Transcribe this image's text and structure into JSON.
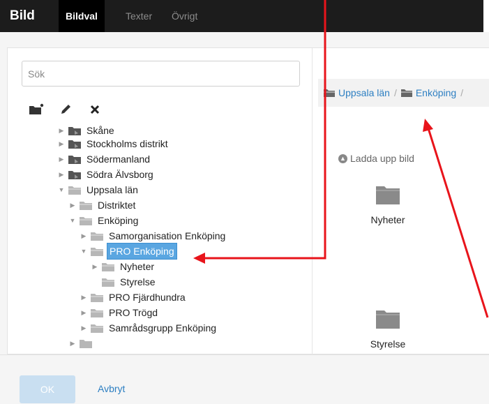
{
  "header": {
    "title": "Bild",
    "tabs": [
      {
        "label": "Bildval",
        "active": true
      },
      {
        "label": "Texter",
        "active": false
      },
      {
        "label": "Övrigt",
        "active": false
      }
    ]
  },
  "search": {
    "placeholder": "Sök",
    "value": ""
  },
  "toolbar": {
    "icons": [
      "new-folder-icon",
      "pencil-icon",
      "delete-icon"
    ]
  },
  "tree": {
    "items": [
      {
        "label": "Skåne",
        "level": 1,
        "expanded": false,
        "partial": true
      },
      {
        "label": "Stockholms distrikt",
        "level": 1,
        "expanded": false
      },
      {
        "label": "Södermanland",
        "level": 1,
        "expanded": false
      },
      {
        "label": "Södra Älvsborg",
        "level": 1,
        "expanded": false
      },
      {
        "label": "Uppsala län",
        "level": 1,
        "expanded": true
      },
      {
        "label": "Distriktet",
        "level": 2,
        "expanded": false
      },
      {
        "label": "Enköping",
        "level": 2,
        "expanded": true
      },
      {
        "label": "Samorganisation Enköping",
        "level": 3,
        "expanded": false
      },
      {
        "label": "PRO Enköping",
        "level": 3,
        "expanded": true,
        "selected": true
      },
      {
        "label": "Nyheter",
        "level": 4,
        "expanded": false
      },
      {
        "label": "Styrelse",
        "level": 4,
        "leaf": true
      },
      {
        "label": "PRO Fjärdhundra",
        "level": 3,
        "expanded": false
      },
      {
        "label": "PRO Trögd",
        "level": 3,
        "expanded": false
      },
      {
        "label": "Samrådsgrupp Enköping",
        "level": 3,
        "expanded": false
      }
    ]
  },
  "breadcrumb": {
    "items": [
      "Uppsala län",
      "Enköping"
    ],
    "separator": "/"
  },
  "upload": {
    "label": "Ladda upp bild"
  },
  "tiles": [
    {
      "label": "Nyheter"
    },
    {
      "label": "Styrelse"
    }
  ],
  "footer": {
    "ok_label": "OK",
    "cancel_label": "Avbryt"
  },
  "colors": {
    "header_bg": "#1c1c1c",
    "selected_bg": "#5aa6e1",
    "link": "#2d7fc2",
    "annotation": "#e8141b"
  }
}
